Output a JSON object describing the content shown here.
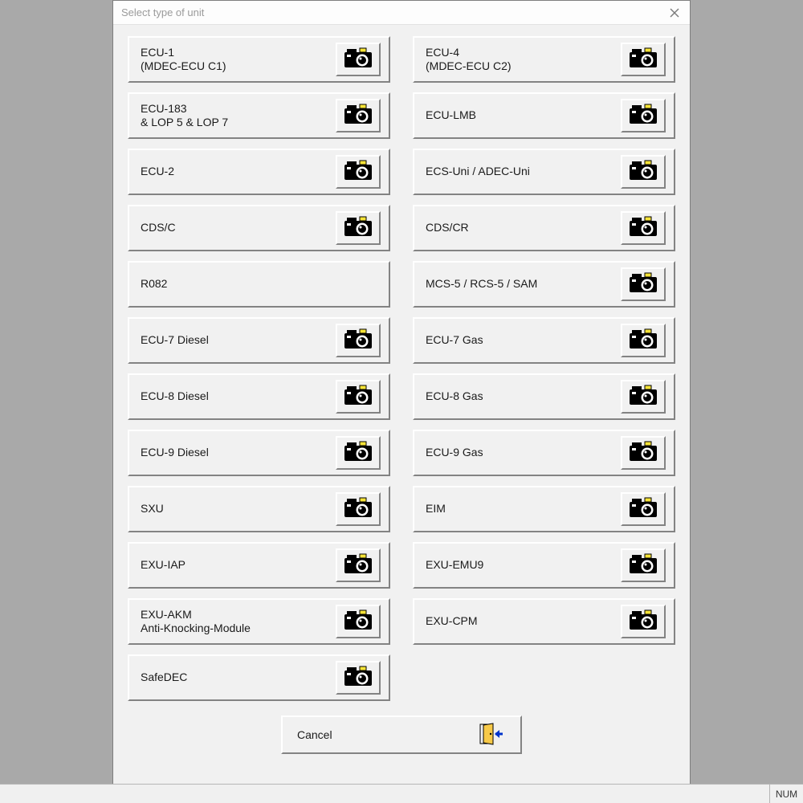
{
  "dialog": {
    "title": "Select type of unit",
    "cancel_label": "Cancel"
  },
  "units": {
    "left": [
      {
        "label": "ECU-1\n(MDEC-ECU C1)",
        "has_cam": true
      },
      {
        "label": "ECU-183\n& LOP 5 & LOP 7",
        "has_cam": true
      },
      {
        "label": "ECU-2",
        "has_cam": true
      },
      {
        "label": "CDS/C",
        "has_cam": true
      },
      {
        "label": "R082",
        "has_cam": false
      },
      {
        "label": "ECU-7 Diesel",
        "has_cam": true
      },
      {
        "label": "ECU-8 Diesel",
        "has_cam": true
      },
      {
        "label": "ECU-9 Diesel",
        "has_cam": true
      },
      {
        "label": "SXU",
        "has_cam": true
      },
      {
        "label": "EXU-IAP",
        "has_cam": true
      },
      {
        "label": "EXU-AKM\nAnti-Knocking-Module",
        "has_cam": true
      },
      {
        "label": "SafeDEC",
        "has_cam": true
      }
    ],
    "right": [
      {
        "label": "ECU-4\n(MDEC-ECU C2)",
        "has_cam": true
      },
      {
        "label": "ECU-LMB",
        "has_cam": true
      },
      {
        "label": "ECS-Uni / ADEC-Uni",
        "has_cam": true
      },
      {
        "label": "CDS/CR",
        "has_cam": true
      },
      {
        "label": "MCS-5 / RCS-5 / SAM",
        "has_cam": true
      },
      {
        "label": "ECU-7 Gas",
        "has_cam": true
      },
      {
        "label": "ECU-8 Gas",
        "has_cam": true
      },
      {
        "label": "ECU-9 Gas",
        "has_cam": true
      },
      {
        "label": "EIM",
        "has_cam": true
      },
      {
        "label": "EXU-EMU9",
        "has_cam": true
      },
      {
        "label": "EXU-CPM",
        "has_cam": true
      }
    ]
  },
  "statusbar": {
    "num": "NUM"
  }
}
